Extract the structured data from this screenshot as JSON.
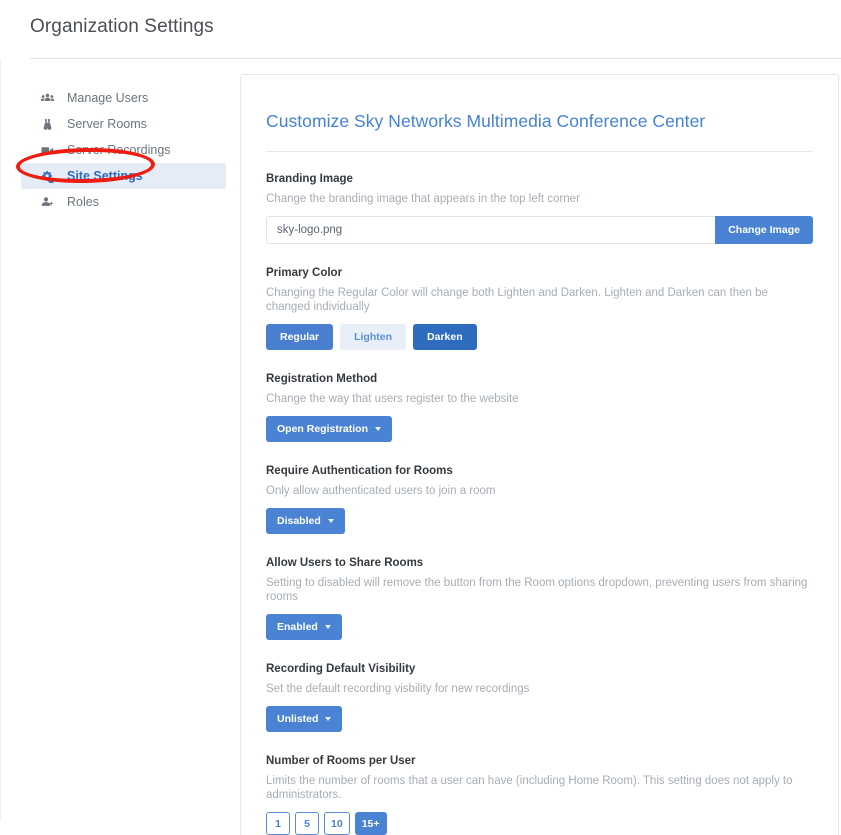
{
  "page": {
    "title": "Organization Settings"
  },
  "sidebar": {
    "items": [
      {
        "label": "Manage Users",
        "icon": "users-group-icon",
        "active": false
      },
      {
        "label": "Server Rooms",
        "icon": "binoculars-icon",
        "active": false
      },
      {
        "label": "Server Recordings",
        "icon": "video-camera-icon",
        "active": false
      },
      {
        "label": "Site Settings",
        "icon": "cogs-icon",
        "active": true
      },
      {
        "label": "Roles",
        "icon": "user-plus-icon",
        "active": false
      }
    ]
  },
  "card": {
    "title": "Customize Sky Networks Multimedia Conference Center",
    "settings": [
      {
        "label": "Branding Image",
        "desc": "Change the branding image that appears in the top left corner",
        "control": "input-group",
        "input_value": "sky-logo.png",
        "input_placeholder": "sky-logo.png",
        "button_label": "Change Image"
      },
      {
        "label": "Primary Color",
        "desc": "Changing the Regular Color will change both Lighten and Darken. Lighten and Darken can then be changed individually",
        "control": "color-buttons",
        "buttons": [
          {
            "label": "Regular",
            "style": "regular"
          },
          {
            "label": "Lighten",
            "style": "lighten"
          },
          {
            "label": "Darken",
            "style": "darken"
          }
        ]
      },
      {
        "label": "Registration Method",
        "desc": "Change the way that users register to the website",
        "control": "dropdown",
        "value": "Open Registration"
      },
      {
        "label": "Require Authentication for Rooms",
        "desc": "Only allow authenticated users to join a room",
        "control": "dropdown",
        "value": "Disabled"
      },
      {
        "label": "Allow Users to Share Rooms",
        "desc": "Setting to disabled will remove the button from the Room options dropdown, preventing users from sharing rooms",
        "control": "dropdown",
        "value": "Enabled"
      },
      {
        "label": "Recording Default Visibility",
        "desc": "Set the default recording visbility for new recordings",
        "control": "dropdown",
        "value": "Unlisted"
      },
      {
        "label": "Number of Rooms per User",
        "desc": "Limits the number of rooms that a user can have (including Home Room). This setting does not apply to administrators.",
        "control": "pills",
        "pills": [
          {
            "label": "1",
            "selected": false
          },
          {
            "label": "5",
            "selected": false
          },
          {
            "label": "10",
            "selected": false
          },
          {
            "label": "15+",
            "selected": true
          }
        ]
      }
    ]
  },
  "annotation": {
    "shape": "ellipse",
    "color": "#ee1c11",
    "targets": "Site Settings"
  },
  "colors": {
    "primary_regular": "#4a7fd0",
    "primary_lighten": "#e8eff9",
    "primary_darken": "#2d6cbf",
    "link_blue": "#4582d4",
    "annotation_red": "#ee1c11",
    "active_nav_bg": "#e6ecf5"
  }
}
